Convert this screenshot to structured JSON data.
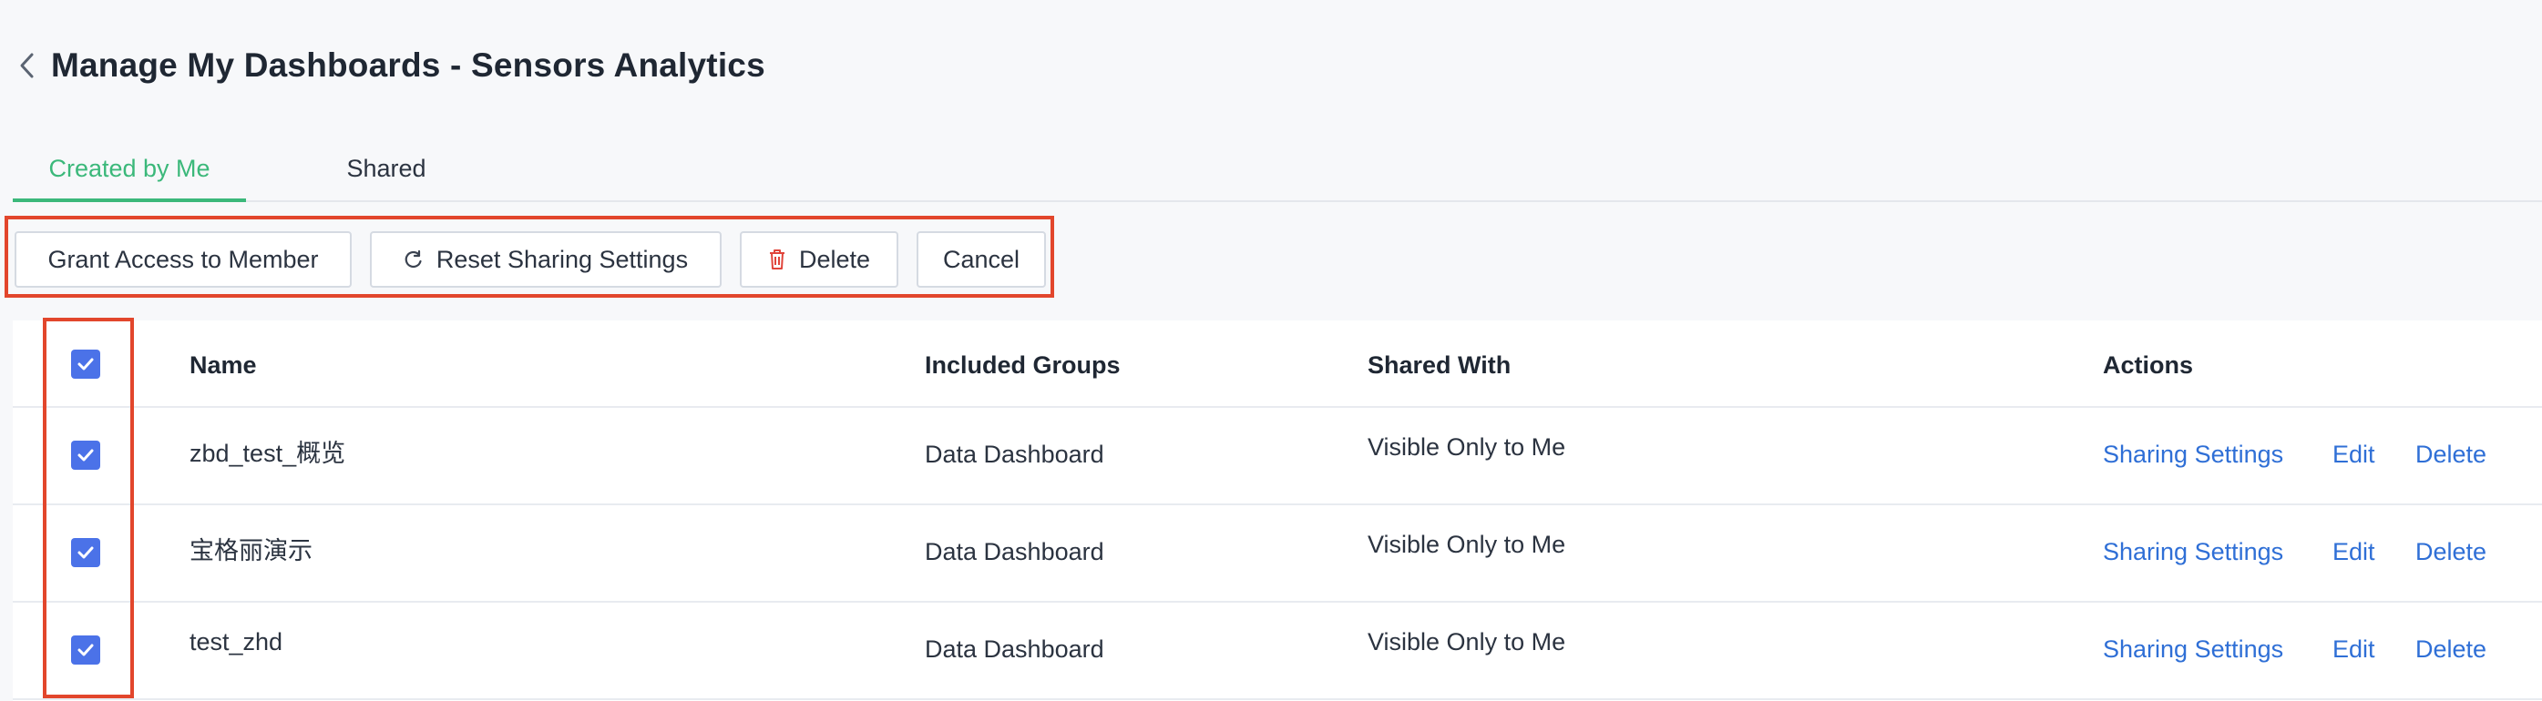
{
  "page": {
    "title": "Manage My Dashboards - Sensors Analytics"
  },
  "tabs": [
    {
      "label": "Created by Me",
      "active": true
    },
    {
      "label": "Shared",
      "active": false
    }
  ],
  "toolbar": {
    "grant_label": "Grant Access to Member",
    "reset_label": "Reset Sharing Settings",
    "delete_label": "Delete",
    "cancel_label": "Cancel"
  },
  "table": {
    "headers": {
      "name": "Name",
      "groups": "Included Groups",
      "shared": "Shared With",
      "actions": "Actions"
    },
    "rows": [
      {
        "name": "zbd_test_概览",
        "groups": "Data Dashboard",
        "shared": "Visible Only to Me",
        "checked": true
      },
      {
        "name": "宝格丽演示",
        "groups": "Data Dashboard",
        "shared": "Visible Only to Me",
        "checked": true
      },
      {
        "name": "test_zhd",
        "groups": "Data Dashboard",
        "shared": "Visible Only to Me",
        "checked": true
      }
    ],
    "actions": {
      "share": "Sharing Settings",
      "edit": "Edit",
      "delete": "Delete"
    },
    "select_all_checked": true
  },
  "colors": {
    "accent": "#3bb87a",
    "link": "#2f6fd6",
    "checkbox": "#4b72e8",
    "highlight": "#e2462c",
    "delete_icon": "#e0443a"
  },
  "icons": {
    "back": "chevron-left-icon",
    "reset": "refresh-icon",
    "delete": "trash-icon",
    "check": "checkmark-icon"
  }
}
